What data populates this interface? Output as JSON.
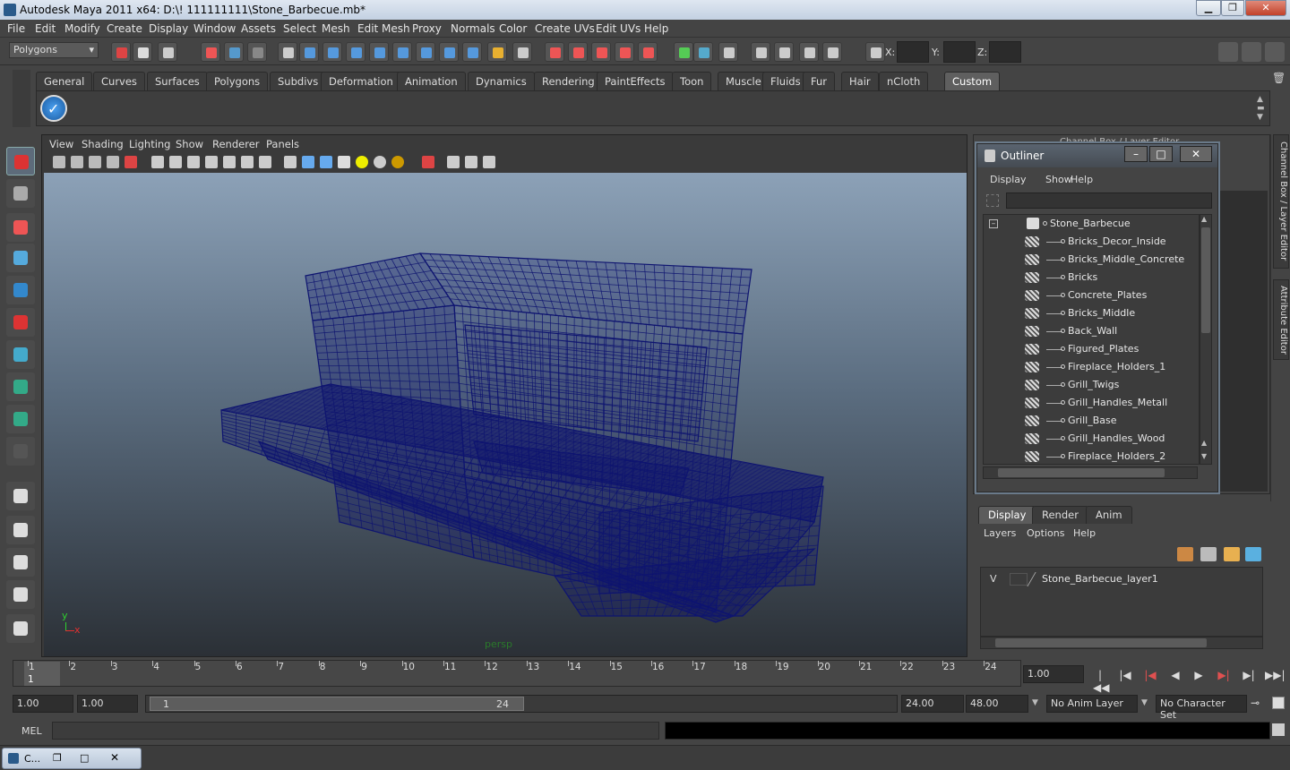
{
  "window": {
    "title": "Autodesk Maya 2011 x64: D:\\! 111111111\\Stone_Barbecue.mb*"
  },
  "menubar": [
    "File",
    "Edit",
    "Modify",
    "Create",
    "Display",
    "Window",
    "Assets",
    "Select",
    "Mesh",
    "Edit Mesh",
    "Proxy",
    "Normals",
    "Color",
    "Create UVs",
    "Edit UVs",
    "Help"
  ],
  "status": {
    "mode": "Polygons",
    "x_label": "X:",
    "y_label": "Y:",
    "z_label": "Z:"
  },
  "shelf_tabs": [
    "General",
    "Curves",
    "Surfaces",
    "Polygons",
    "Subdivs",
    "Deformation",
    "Animation",
    "Dynamics",
    "Rendering",
    "PaintEffects",
    "Toon",
    "Muscle",
    "Fluids",
    "Fur",
    "Hair",
    "nCloth",
    "Custom"
  ],
  "shelf_active": "Custom",
  "viewport": {
    "menu": [
      "View",
      "Shading",
      "Lighting",
      "Show",
      "Renderer",
      "Panels"
    ],
    "camera_label": "persp",
    "axis_x": "x",
    "axis_y": "y"
  },
  "outliner": {
    "title": "Outliner",
    "menu": [
      "Display",
      "Show",
      "Help"
    ],
    "root": "Stone_Barbecue",
    "items": [
      "Bricks_Decor_Inside",
      "Bricks_Middle_Concrete",
      "Bricks",
      "Concrete_Plates",
      "Bricks_Middle",
      "Back_Wall",
      "Figured_Plates",
      "Fireplace_Holders_1",
      "Grill_Twigs",
      "Grill_Handles_Metall",
      "Grill_Base",
      "Grill_Handles_Wood",
      "Fireplace_Holders_2"
    ]
  },
  "channel_box": {
    "title": "Channel Box / Layer Editor",
    "side_tab_1": "Channel Box / Layer Editor",
    "side_tab_2": "Attribute Editor"
  },
  "layers": {
    "tabs": [
      "Display",
      "Render",
      "Anim"
    ],
    "active_tab": "Display",
    "menu": [
      "Layers",
      "Options",
      "Help"
    ],
    "layer": {
      "visible": "V",
      "name": "Stone_Barbecue_layer1"
    }
  },
  "timeline": {
    "ticks": [
      "1",
      "2",
      "3",
      "4",
      "5",
      "6",
      "7",
      "8",
      "9",
      "10",
      "11",
      "12",
      "13",
      "14",
      "15",
      "16",
      "17",
      "18",
      "19",
      "20",
      "21",
      "22",
      "23",
      "24"
    ],
    "current_marker": "1",
    "current_frame": "1.00"
  },
  "range": {
    "start": "1.00",
    "playback_start": "1.00",
    "slider_start": "1",
    "slider_end": "24",
    "playback_end": "24.00",
    "end": "48.00",
    "anim_layer": "No Anim Layer",
    "character_set": "No Character Set"
  },
  "command": {
    "label": "MEL"
  },
  "taskbar": {
    "label": "C..."
  },
  "colors": {
    "wire": "#0e1470",
    "panel": "#444444",
    "accent": "#2a7a2a"
  }
}
